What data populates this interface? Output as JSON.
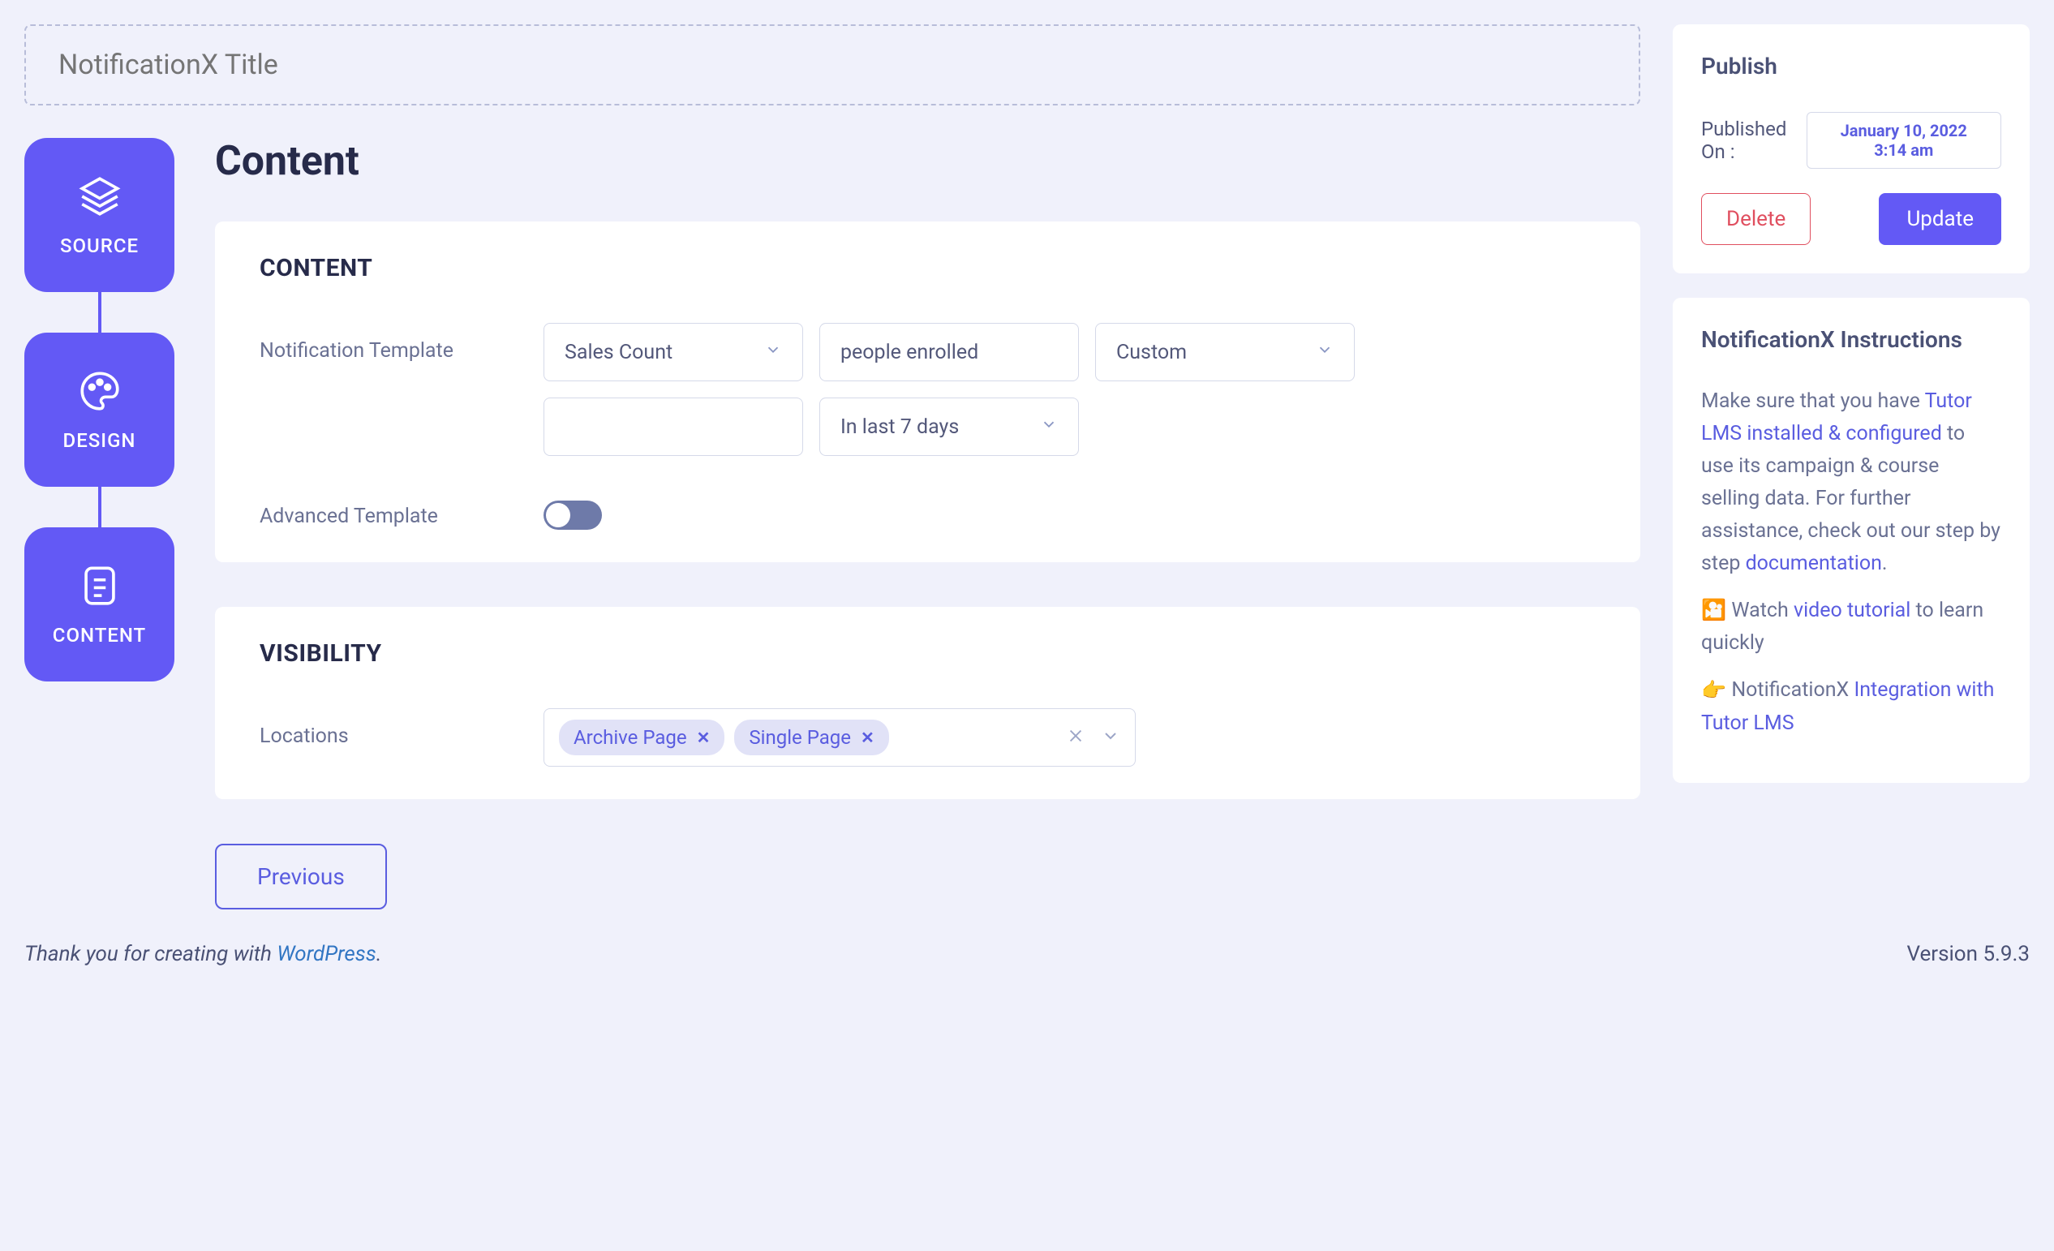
{
  "title_placeholder": "NotificationX Title",
  "steps": [
    {
      "label": "SOURCE"
    },
    {
      "label": "DESIGN"
    },
    {
      "label": "CONTENT"
    }
  ],
  "page_heading": "Content",
  "content_card": {
    "title": "CONTENT",
    "template_label": "Notification Template",
    "advanced_label": "Advanced Template",
    "field1": "Sales Count",
    "field2": "people enrolled",
    "field3": "Custom",
    "field4": "",
    "field5": "In last 7 days"
  },
  "visibility_card": {
    "title": "VISIBILITY",
    "locations_label": "Locations",
    "tags": [
      "Archive Page",
      "Single Page"
    ]
  },
  "previous_button": "Previous",
  "publish": {
    "title": "Publish",
    "label": "Published On :",
    "date": "January 10, 2022 3:14 am",
    "delete": "Delete",
    "update": "Update"
  },
  "instructions": {
    "title": "NotificationX Instructions",
    "p1_a": "Make sure that you have ",
    "p1_link1": "Tutor LMS installed & configured",
    "p1_b": " to use its campaign & course selling data. For further assistance, check out our step by step ",
    "p1_link2": "documentation",
    "p1_c": ".",
    "p2_a": " Watch ",
    "p2_link": "video tutorial",
    "p2_b": " to learn quickly",
    "p3_a": " NotificationX ",
    "p3_link": "Integration with Tutor LMS"
  },
  "footer": {
    "thanks_a": "Thank you for creating with ",
    "thanks_link": "WordPress",
    "thanks_b": ".",
    "version": "Version 5.9.3"
  }
}
